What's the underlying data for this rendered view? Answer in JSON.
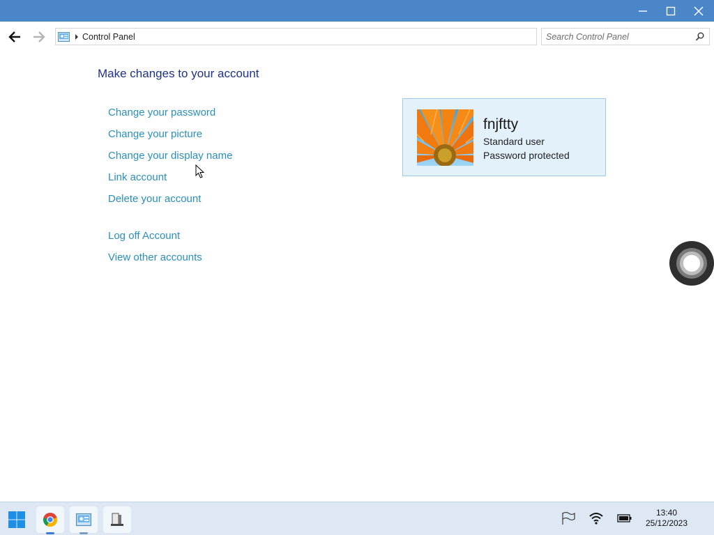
{
  "window": {
    "controls": [
      "minimize-icon",
      "maximize-icon",
      "close-icon"
    ],
    "titlebar_color": "#4a86c8"
  },
  "navigation": {
    "back_icon": "back-arrow-icon",
    "forward_icon": "forward-arrow-icon",
    "breadcrumb": "Control Panel",
    "search_placeholder": "Search Control Panel"
  },
  "main": {
    "heading": "Make changes to your account",
    "links": [
      "Change your password",
      "Change your picture",
      "Change your display name",
      "Link account",
      "Delete your account"
    ],
    "secondary_links": [
      "Log off Account",
      "View other accounts"
    ],
    "link_color": "#2a8fbd"
  },
  "account": {
    "name": "fnjftty",
    "type": "Standard user",
    "status": "Password protected",
    "picture": "orange-flower-avatar"
  },
  "taskbar": {
    "apps": [
      "start-icon",
      "chrome-icon",
      "control-panel-icon",
      "file-explorer-icon"
    ],
    "tray": [
      "flag-icon",
      "wifi-icon",
      "battery-icon"
    ],
    "time": "13:40",
    "date": "25/12/2023"
  }
}
